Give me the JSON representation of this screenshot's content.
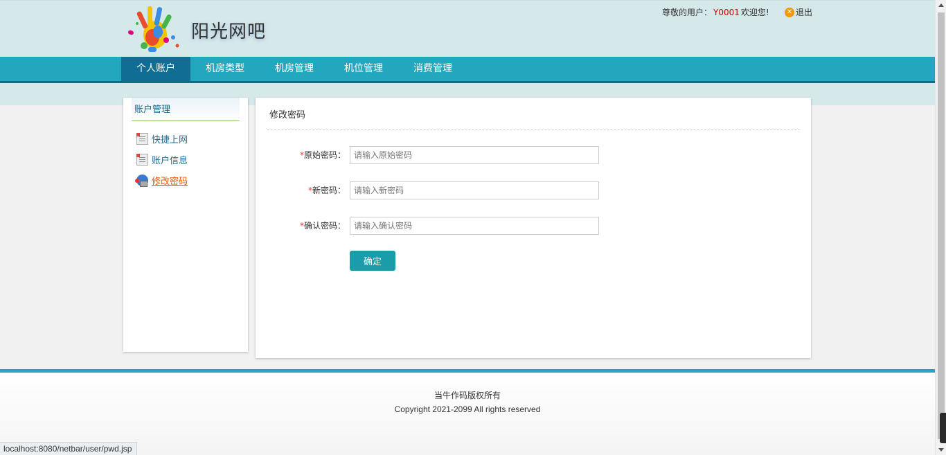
{
  "header": {
    "brand": "阳光网吧",
    "greeting_prefix": "尊敬的用户：",
    "user_id": "Y0001",
    "greeting_suffix": "欢迎您!",
    "logout_label": "退出",
    "logout_icon": "close-circle-icon",
    "logout_icon_glyph": "✕"
  },
  "nav": {
    "items": [
      {
        "label": "个人账户",
        "active": true
      },
      {
        "label": "机房类型",
        "active": false
      },
      {
        "label": "机房管理",
        "active": false
      },
      {
        "label": "机位管理",
        "active": false
      },
      {
        "label": "消费管理",
        "active": false
      }
    ]
  },
  "sidebar": {
    "title": "账户管理",
    "items": [
      {
        "label": "快捷上网",
        "icon": "note-icon"
      },
      {
        "label": "账户信息",
        "icon": "note-icon"
      },
      {
        "label": "修改密码",
        "icon": "lock-icon",
        "active": true
      }
    ]
  },
  "panel": {
    "title": "修改密码",
    "required_mark": "*",
    "fields": [
      {
        "label": "原始密码：",
        "placeholder": "请输入原始密码",
        "value": ""
      },
      {
        "label": "新密码：",
        "placeholder": "请输入新密码",
        "value": ""
      },
      {
        "label": "确认密码：",
        "placeholder": "请输入确认密码",
        "value": ""
      }
    ],
    "submit_label": "确定"
  },
  "footer": {
    "line1": "当牛作码版权所有",
    "line2": "Copyright 2021-2099 All rights reserved"
  },
  "statusbar": {
    "url": "localhost:8080/netbar/user/pwd.jsp"
  },
  "colors": {
    "nav_bg": "#23a7be",
    "nav_active": "#106e94",
    "header_bg": "#d5e8ea",
    "button": "#1a9cab",
    "user_id": "#cc0000",
    "active_link": "#e8590c"
  }
}
